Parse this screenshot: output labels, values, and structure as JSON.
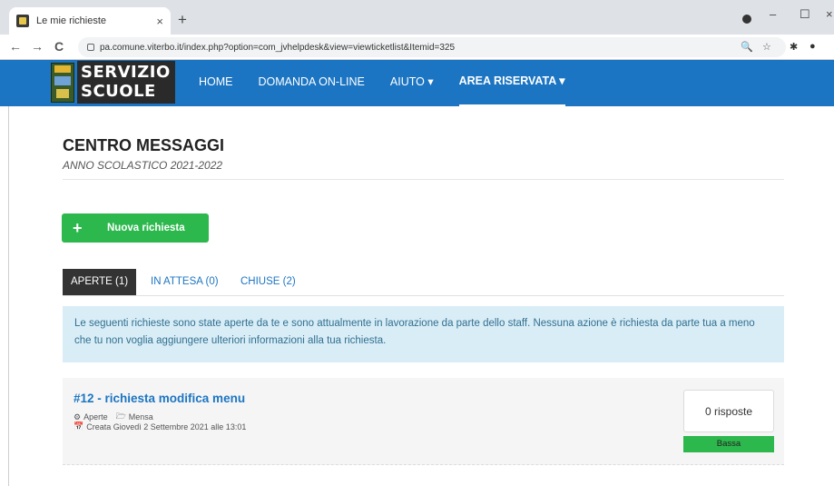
{
  "browser": {
    "tab_title": "Le mie richieste",
    "tab_close": "×",
    "new_tab": "+",
    "url": "pa.comune.viterbo.it/index.php?option=com_jvhelpdesk&view=viewticketlist&Itemid=325",
    "back": "←",
    "forward": "→",
    "reload": "C",
    "minimize": "–",
    "maximize": "☐",
    "close": "×",
    "zoom_icon": "🔍",
    "star_icon": "☆",
    "puzzle_icon": "✱",
    "profile_icon": "●"
  },
  "site": {
    "logo_line1": "SERVIZIO",
    "logo_line2": "SCUOLE",
    "menu": [
      {
        "label": "HOME"
      },
      {
        "label": "DOMANDA ON-LINE"
      },
      {
        "label": "AIUTO ▾"
      },
      {
        "label": "AREA RISERVATA ▾"
      }
    ]
  },
  "page": {
    "title": "CENTRO MESSAGGI",
    "subtitle": "ANNO SCOLASTICO 2021-2022",
    "new_request": "Nuova richiesta",
    "new_request_icon": "+",
    "tabs": [
      {
        "label": "APERTE (1)"
      },
      {
        "label": "IN ATTESA (0)"
      },
      {
        "label": "CHIUSE (2)"
      }
    ],
    "info": "Le seguenti richieste sono state aperte da te e sono attualmente in lavorazione da parte dello staff. Nessuna azione è richiesta da parte tua a meno che tu non voglia aggiungere ulteriori informazioni alla tua richiesta."
  },
  "ticket": {
    "title": "#12 - richiesta modifica menu",
    "status": "Aperte",
    "category": "Mensa",
    "created": "Creata Giovedì 2 Settembre 2021 alle 13:01",
    "replies": "0 risposte",
    "priority": "Bassa",
    "status_icon": "⚙",
    "category_icon": "🗁",
    "date_icon": "📅"
  },
  "colors": {
    "primary": "#1c75c2",
    "success": "#2db84d",
    "info_bg": "#d9edf7",
    "info_text": "#31708f"
  }
}
